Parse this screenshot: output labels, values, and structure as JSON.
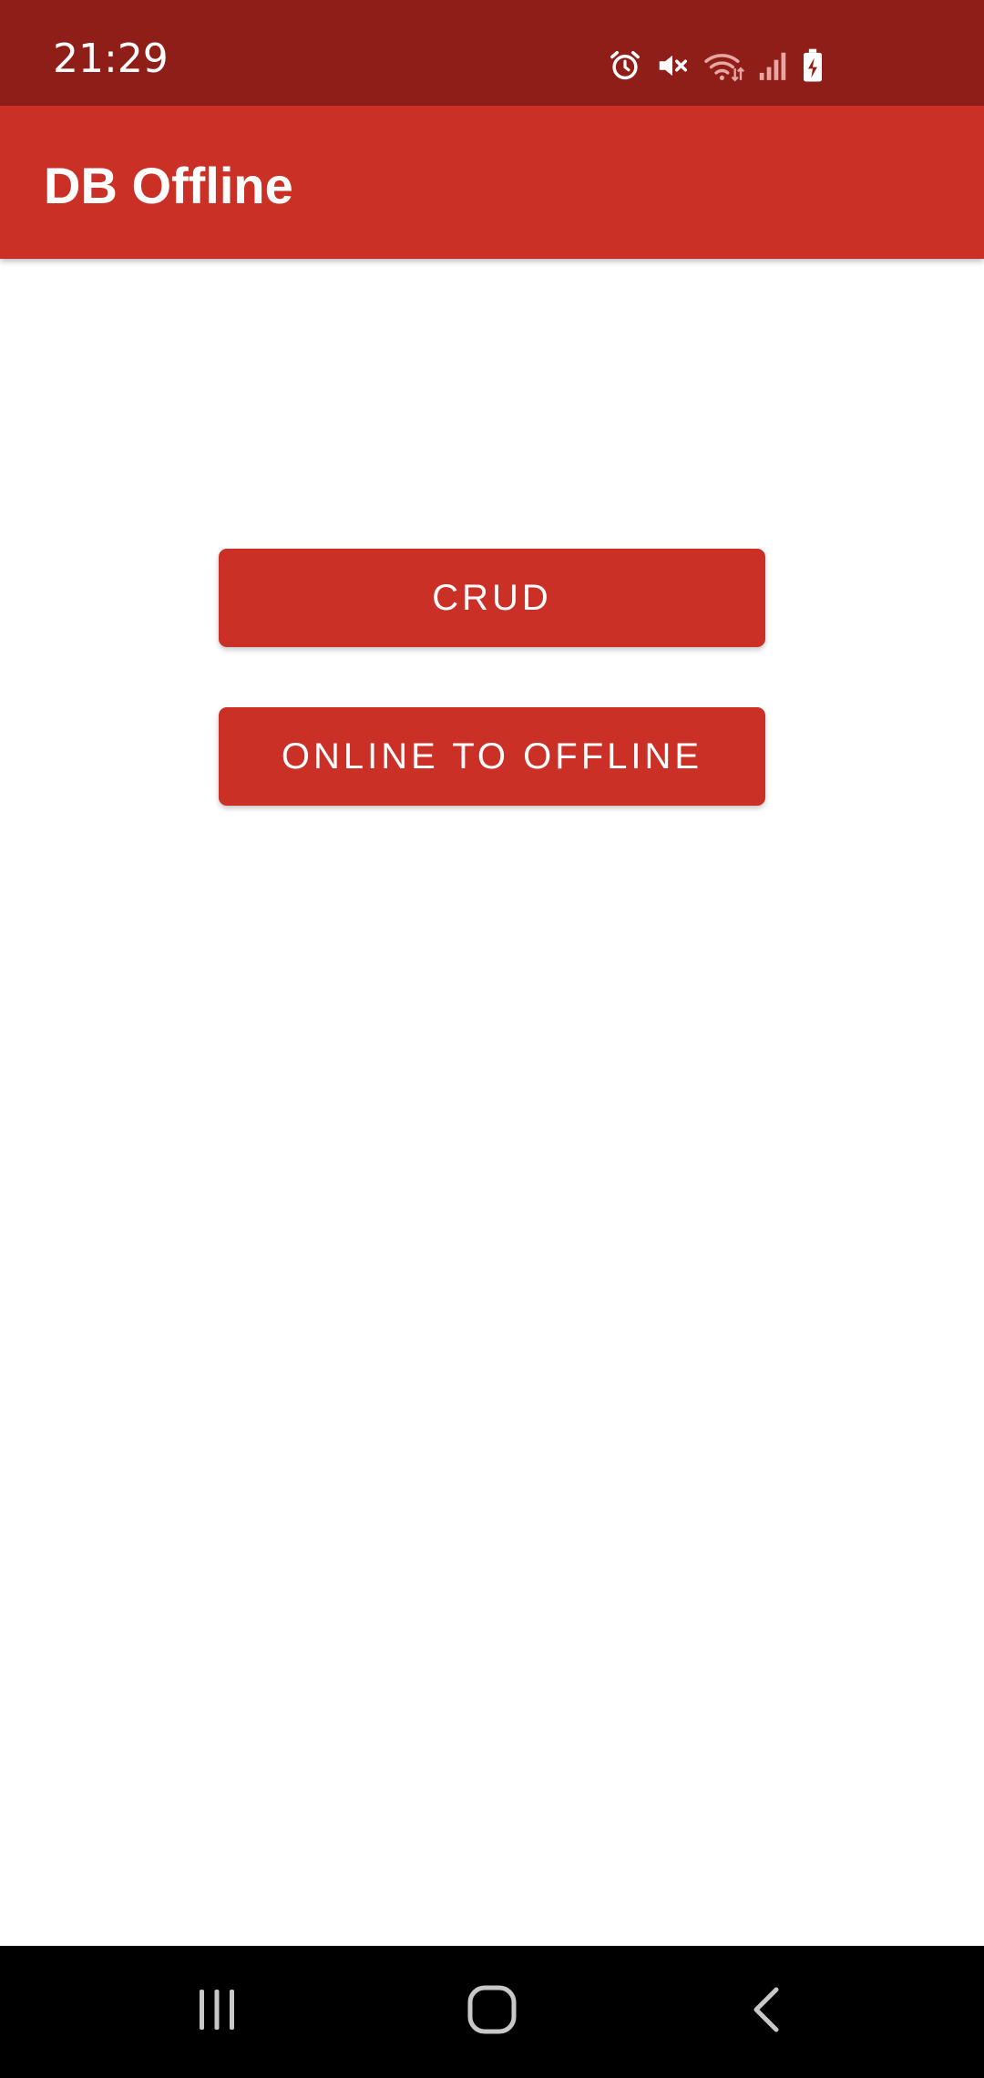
{
  "status_bar": {
    "time": "21:29",
    "icons": [
      "alarm-icon",
      "mute-icon",
      "wifi-icon",
      "signal-icon",
      "battery-charging-icon"
    ]
  },
  "app_bar": {
    "title": "DB Offline"
  },
  "buttons": {
    "crud_label": "CRUD",
    "online_to_offline_label": "ONLINE TO OFFLINE"
  },
  "nav_bar": {
    "icons": [
      "recents-icon",
      "home-icon",
      "back-icon"
    ]
  },
  "colors": {
    "status_bar": "#8f1d18",
    "primary": "#cb3027",
    "background": "#ffffff",
    "nav_bar": "#000000"
  }
}
